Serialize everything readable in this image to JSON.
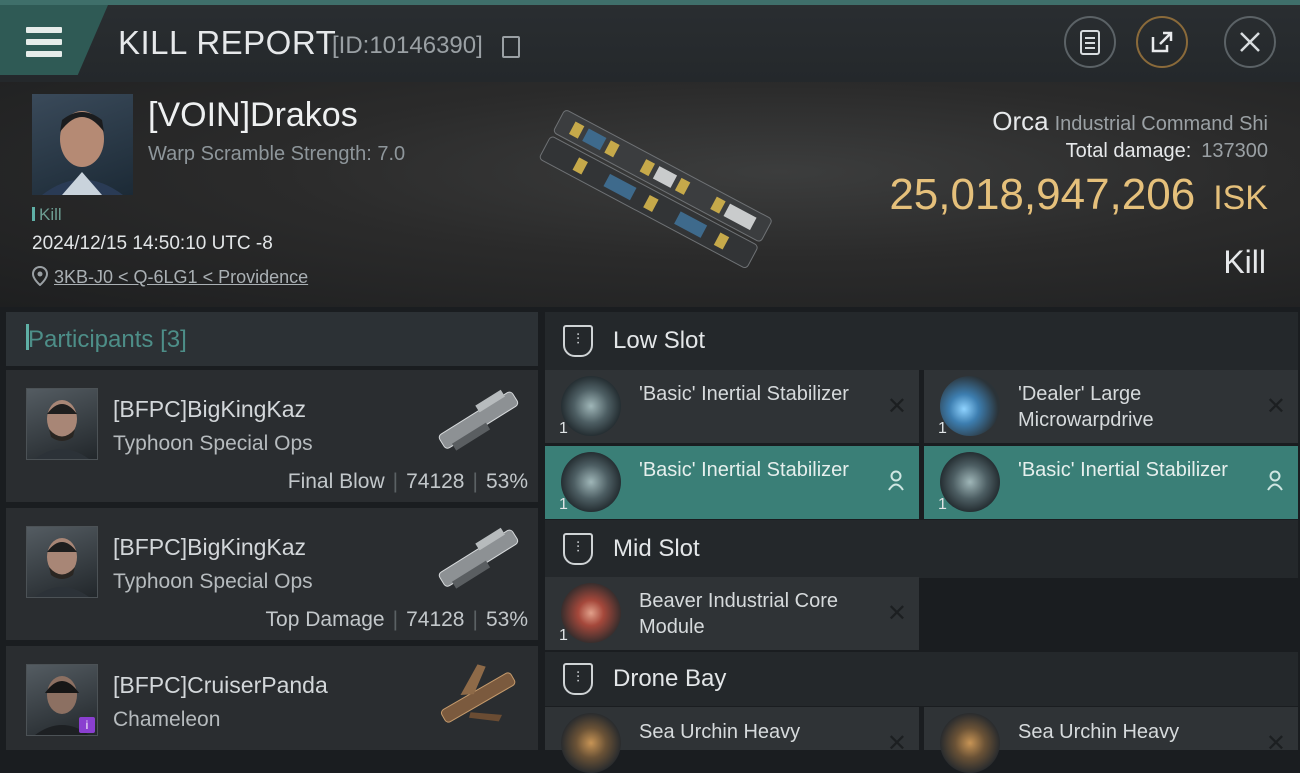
{
  "header": {
    "title": "KILL REPORT",
    "kill_id": "[ID:10146390]",
    "buttons": [
      "clipboard-icon",
      "share-icon",
      "close-icon"
    ]
  },
  "victim": {
    "name": "[VOIN]Drakos",
    "warp_scramble": "Warp Scramble Strength: 7.0",
    "tag": "Kill",
    "timestamp": "2024/12/15 14:50:10 UTC -8",
    "location": "3KB-J0 < Q-6LG1 < Providence"
  },
  "ship": {
    "name": "Orca",
    "class": "Industrial Command Shi",
    "total_damage_label": "Total damage:",
    "total_damage": "137300",
    "isk_value": "25,018,947,206",
    "isk_unit": "ISK",
    "result": "Kill"
  },
  "participants": {
    "label": "Participants",
    "count": "[3]",
    "items": [
      {
        "name": "[BFPC]BigKingKaz",
        "ship": "Typhoon Special Ops",
        "role": "Final Blow",
        "damage": "74128",
        "pct": "53%"
      },
      {
        "name": "[BFPC]BigKingKaz",
        "ship": "Typhoon Special Ops",
        "role": "Top Damage",
        "damage": "74128",
        "pct": "53%"
      },
      {
        "name": "[BFPC]CruiserPanda",
        "ship": "Chameleon",
        "role": "",
        "damage": "",
        "pct": ""
      }
    ]
  },
  "slots": {
    "low": {
      "label": "Low Slot",
      "items": [
        {
          "name": "'Basic' Inertial Stabilizer",
          "qty": "1",
          "state": "destroyed"
        },
        {
          "name": "'Dealer' Large Microwarpdrive",
          "qty": "1",
          "state": "destroyed"
        },
        {
          "name": "'Basic' Inertial Stabilizer",
          "qty": "1",
          "state": "dropped"
        },
        {
          "name": "'Basic' Inertial Stabilizer",
          "qty": "1",
          "state": "dropped"
        }
      ]
    },
    "mid": {
      "label": "Mid Slot",
      "items": [
        {
          "name": "Beaver Industrial Core Module",
          "qty": "1",
          "state": "destroyed"
        }
      ]
    },
    "drone": {
      "label": "Drone Bay",
      "items": [
        {
          "name": "Sea Urchin Heavy",
          "qty": "",
          "state": "destroyed"
        },
        {
          "name": "Sea Urchin Heavy",
          "qty": "",
          "state": "destroyed"
        }
      ]
    }
  },
  "colors": {
    "accent": "#3a7f77",
    "isk": "#e5c07b",
    "participants_label": "#4d8e88"
  }
}
